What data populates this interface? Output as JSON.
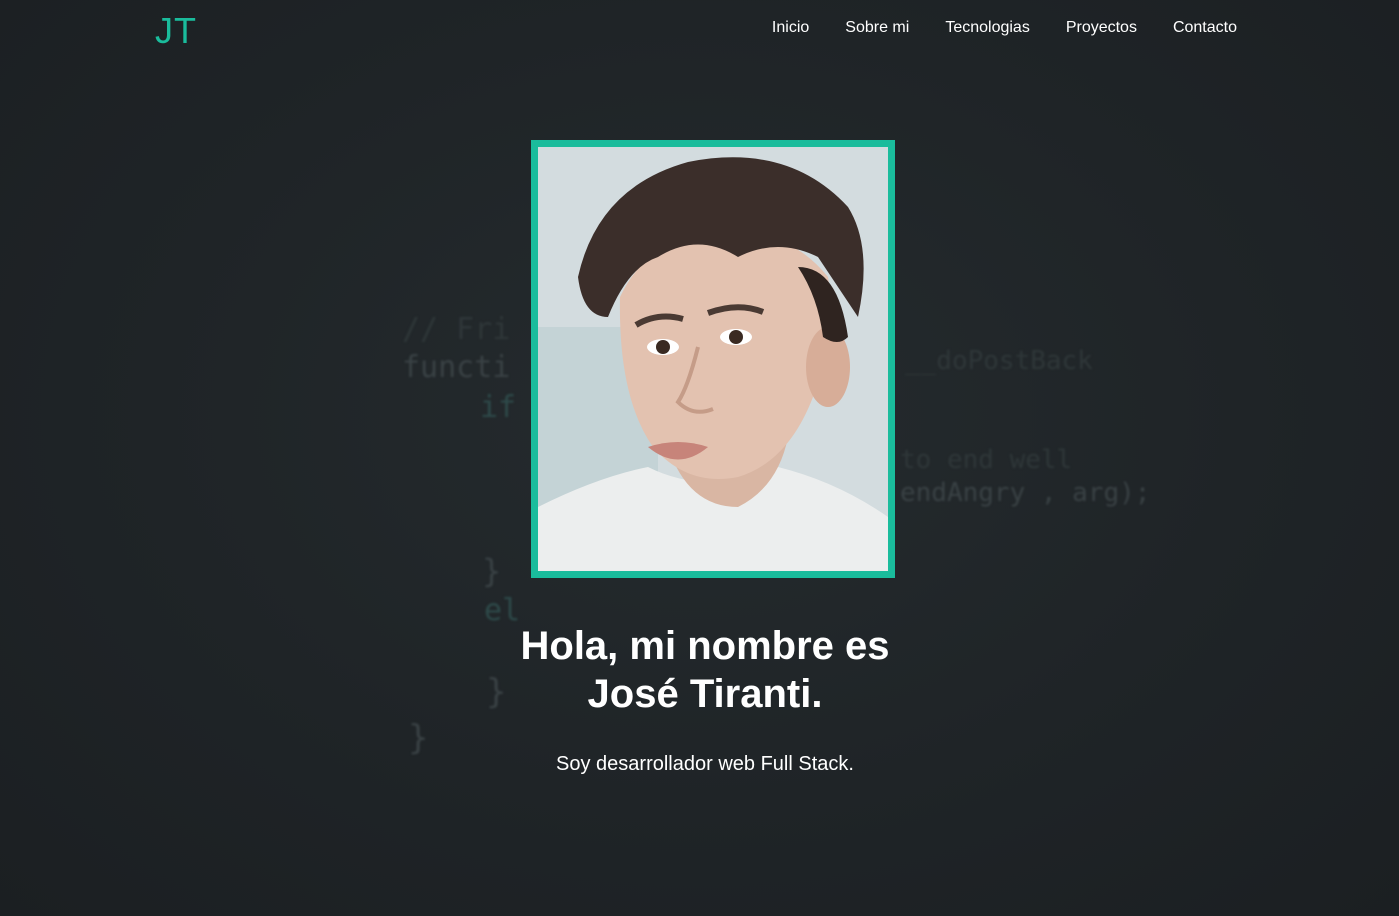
{
  "header": {
    "logo": "JT",
    "nav": [
      {
        "label": "Inicio"
      },
      {
        "label": "Sobre mi"
      },
      {
        "label": "Tecnologias"
      },
      {
        "label": "Proyectos"
      },
      {
        "label": "Contacto"
      }
    ]
  },
  "background_code": [
    "// Fri",
    "functi",
    "if",
    "__doPostBack",
    "to end well",
    "endAngry , arg);",
    "}",
    "el",
    "}",
    "}"
  ],
  "hero": {
    "title": "Hola, mi nombre es José Tiranti.",
    "subtitle": "Soy desarrollador web Full Stack."
  },
  "colors": {
    "accent": "#1abc9c",
    "background": "#1e2326",
    "text": "#ffffff"
  }
}
